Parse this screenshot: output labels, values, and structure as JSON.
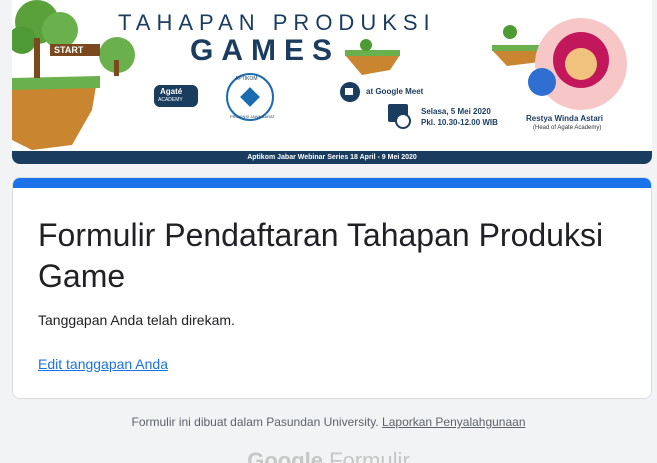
{
  "banner": {
    "title_line1": "TAHAPAN PRODUKSI",
    "title_line2": "GAMES",
    "start_sign": "START",
    "meet_text": "at Google Meet",
    "date_line1": "Selasa, 5 Mei 2020",
    "date_line2": "Pkl. 10.30-12.00 WIB",
    "speaker_name": "Restya Winda Astari",
    "speaker_role": "(Head of Agate Academy)",
    "footer_text": "Aptikom Jabar Webinar Series  18 April - 9 Mei 2020",
    "logo_agate": "Agaté",
    "logo_agate_sub": "ACADEMY",
    "logo_aptikom": "APTIKOM",
    "logo_aptikom_sub": "PROVINSI JAWA BARAT"
  },
  "form": {
    "title": "Formulir Pendaftaran Tahapan Produksi Game",
    "response_msg": "Tanggapan Anda telah direkam.",
    "edit_link": "Edit tanggapan Anda"
  },
  "footer": {
    "created_text": "Formulir ini dibuat dalam Pasundan University.",
    "report_link": "Laporkan Penyalahgunaan",
    "logo_google": "Google",
    "logo_product": "Formulir"
  },
  "colors": {
    "accent": "#1a73e8",
    "banner_navy": "#1a3c5e",
    "background": "#f1f3f4"
  }
}
